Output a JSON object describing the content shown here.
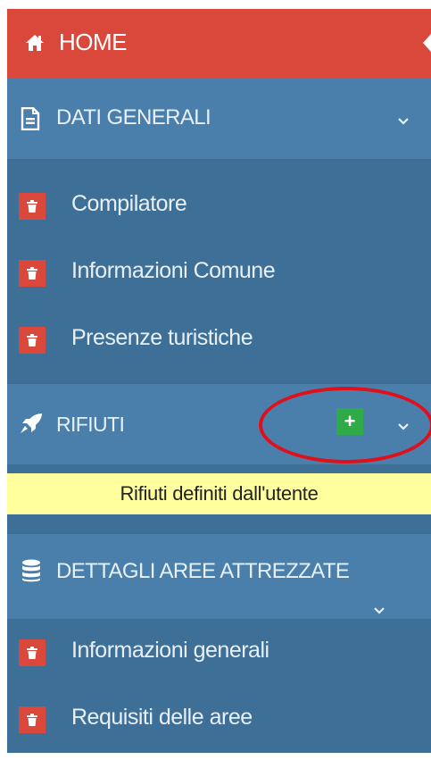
{
  "menu": {
    "home": {
      "label": "HOME",
      "icon": "home-icon"
    },
    "dati_generali": {
      "label": "DATI GENERALI",
      "icon": "document-icon",
      "items": [
        {
          "label": "Compilatore",
          "icon": "trash-icon"
        },
        {
          "label": "Informazioni Comune",
          "icon": "trash-icon"
        },
        {
          "label": "Presenze turistiche",
          "icon": "trash-icon"
        }
      ]
    },
    "rifiuti": {
      "label": "RIFIUTI",
      "icon": "rocket-icon",
      "add_label": "+",
      "tooltip": "Rifiuti definiti dall'utente"
    },
    "dettagli": {
      "label": "DETTAGLI AREE ATTREZZATE",
      "icon": "database-icon",
      "items": [
        {
          "label": "Informazioni generali",
          "icon": "trash-icon"
        },
        {
          "label": "Requisiti delle aree",
          "icon": "trash-icon"
        }
      ]
    }
  },
  "colors": {
    "sidebar_bg": "#3e6f97",
    "section_bg": "#4a7fab",
    "home_bg": "#d9483b",
    "trash_bg": "#d9483b",
    "add_button_bg": "#2eaa47",
    "tooltip_bg": "#ffff9e",
    "annotation_circle": "#e0101a"
  }
}
